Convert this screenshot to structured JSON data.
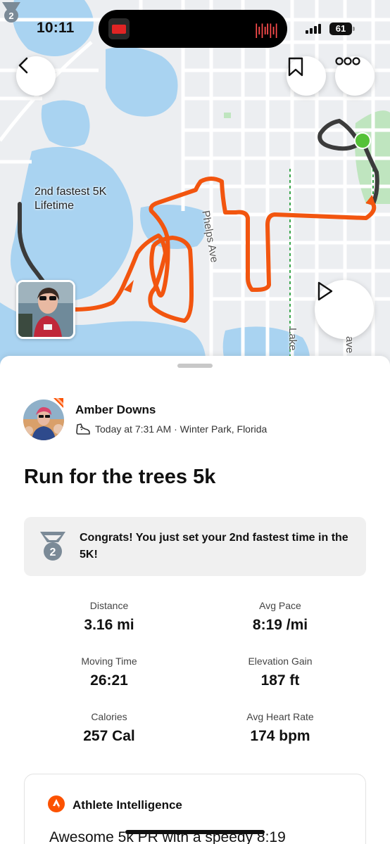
{
  "status_bar": {
    "time": "10:11",
    "battery": "61",
    "colors": {
      "recording": "#ff4d4d",
      "app_icon": "#e02424"
    }
  },
  "map": {
    "street_labels": [
      "Phelps Ave",
      "Lake",
      "ave"
    ],
    "pr_label_line1": "2nd fastest 5K",
    "pr_label_line2": "Lifetime",
    "pr_rank": "2",
    "colors": {
      "route": "#f2550f",
      "route_dark": "#3b3b3b",
      "water": "#a9d3f1",
      "park": "#bfe5bf",
      "end_dot": "#55c238",
      "road": "#ffffff",
      "land": "#eceef1"
    },
    "icons": [
      "chevron-left-icon",
      "bookmark-icon",
      "more-horizontal-icon",
      "play-icon",
      "medal-icon"
    ]
  },
  "activity": {
    "athlete_name": "Amber Downs",
    "timestamp": "Today at 7:31 AM · Winter Park, Florida",
    "title": "Run for the trees 5k",
    "congrats": "Congrats! You just set your 2nd fastest time in the 5K!",
    "congrats_rank": "2",
    "stats": [
      {
        "label": "Distance",
        "value": "3.16 mi"
      },
      {
        "label": "Avg Pace",
        "value": "8:19 /mi"
      },
      {
        "label": "Moving Time",
        "value": "26:21"
      },
      {
        "label": "Elevation Gain",
        "value": "187 ft"
      },
      {
        "label": "Calories",
        "value": "257 Cal"
      },
      {
        "label": "Avg Heart Rate",
        "value": "174 bpm"
      }
    ]
  },
  "athlete_intelligence": {
    "title": "Athlete Intelligence",
    "body": "Awesome 5k PR with a speedy 8:19",
    "accent": "#fc5200"
  }
}
